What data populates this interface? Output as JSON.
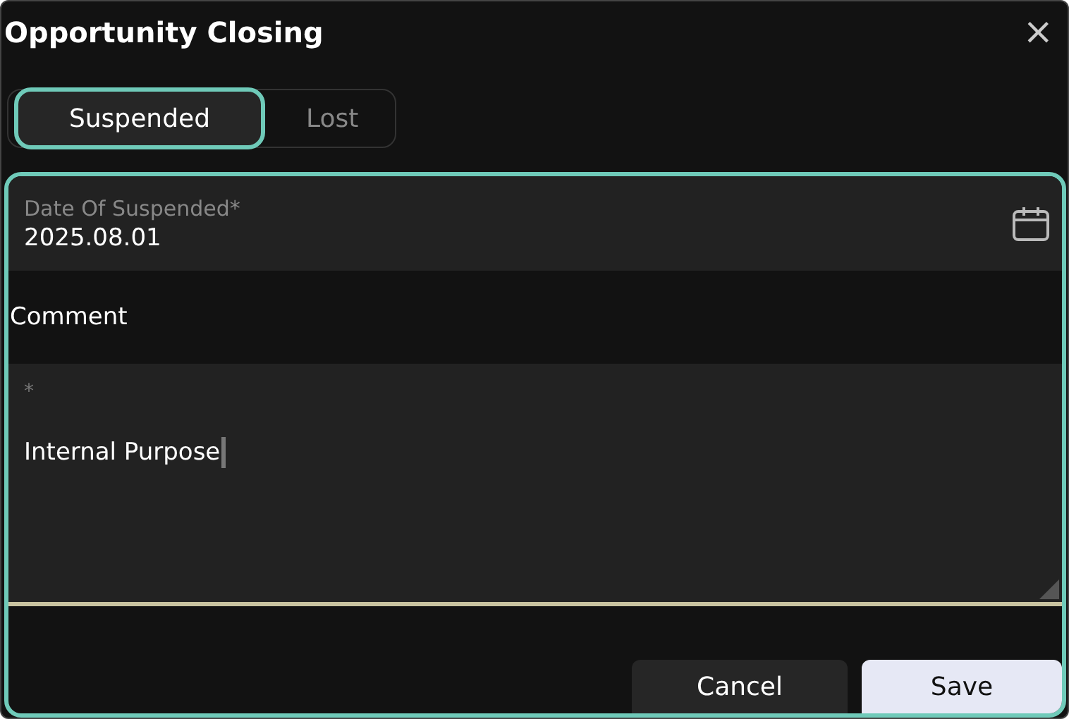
{
  "dialog": {
    "title": "Opportunity Closing",
    "close": "×"
  },
  "tabs": [
    {
      "label": "Suspended",
      "selected": true
    },
    {
      "label": "Lost",
      "selected": false
    }
  ],
  "date_field": {
    "label": "Date Of Suspended*",
    "value": "2025.08.01"
  },
  "comment": {
    "heading": "Comment",
    "label": "*",
    "value": "Internal Purpose"
  },
  "buttons": [
    {
      "label": "Cancel",
      "kind": "secondary"
    },
    {
      "label": "Save",
      "kind": "primary"
    }
  ]
}
